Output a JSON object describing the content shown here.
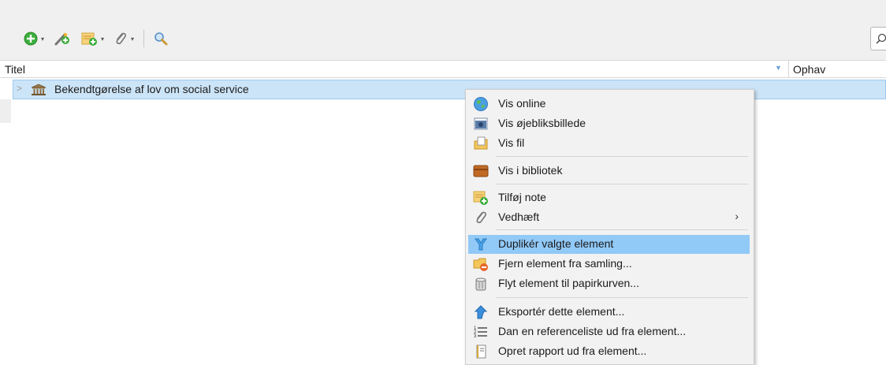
{
  "toolbar": {
    "icons": [
      "new-item-icon",
      "wand-icon",
      "new-note-icon",
      "attach-icon",
      "search-icon"
    ],
    "dropdown_arrow": "▾"
  },
  "columns": {
    "title": "Titel",
    "creator": "Ophav"
  },
  "row": {
    "title": "Bekendtgørelse af lov om social service"
  },
  "context_menu": {
    "items": [
      {
        "label": "Vis online",
        "icon": "globe-icon"
      },
      {
        "label": "Vis øjebliksbillede",
        "icon": "snapshot-icon"
      },
      {
        "label": "Vis fil",
        "icon": "file-icon"
      },
      {
        "label": "Vis i bibliotek",
        "icon": "library-icon"
      },
      {
        "label": "Tilføj note",
        "icon": "note-add-icon"
      },
      {
        "label": "Vedhæft",
        "icon": "paperclip-icon",
        "submenu": "›"
      },
      {
        "label": "Duplikér valgte element",
        "icon": "duplicate-icon"
      },
      {
        "label": "Fjern element fra samling...",
        "icon": "folder-remove-icon"
      },
      {
        "label": "Flyt element til papirkurven...",
        "icon": "trash-icon"
      },
      {
        "label": "Eksportér dette element...",
        "icon": "export-icon"
      },
      {
        "label": "Dan en referenceliste ud fra element...",
        "icon": "list-icon"
      },
      {
        "label": "Opret rapport ud fra element...",
        "icon": "report-icon"
      }
    ]
  },
  "colors": {
    "selection": "#cce4f7",
    "menu_highlight": "#91c9f7",
    "menu_bg": "#f2f2f2"
  }
}
